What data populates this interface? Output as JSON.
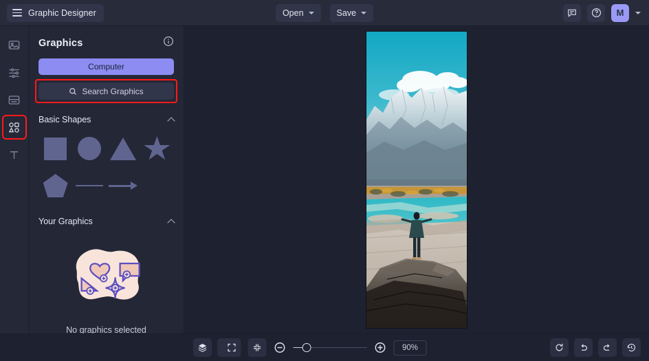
{
  "app": {
    "title": "Graphic Designer",
    "menu_icon": "hamburger-icon"
  },
  "topbar": {
    "open_label": "Open",
    "save_label": "Save",
    "comment_icon": "comment-icon",
    "help_icon": "help-circle-icon",
    "avatar_initial": "M",
    "avatar_color": "#9a9af6",
    "account_chevron": "chevron-down-icon"
  },
  "rail": {
    "items": [
      {
        "icon": "image-icon",
        "name": "images",
        "selected": false
      },
      {
        "icon": "sliders-icon",
        "name": "adjustments",
        "selected": false
      },
      {
        "icon": "layout-icon",
        "name": "pages",
        "selected": false
      },
      {
        "icon": "shapes-icon",
        "name": "graphics",
        "selected": true
      },
      {
        "icon": "text-icon",
        "name": "text",
        "selected": false
      }
    ],
    "highlight_color": "#ff1a1a"
  },
  "panel": {
    "title": "Graphics",
    "info_icon": "info-circle-icon",
    "computer_button": "Computer",
    "computer_button_color": "#8c8cf2",
    "search_button": "Search Graphics",
    "search_icon": "search-icon",
    "search_highlighted": true,
    "sections": [
      {
        "title": "Basic Shapes",
        "chevron": "chevron-up-icon",
        "shapes": [
          {
            "name": "square-shape",
            "kind": "square"
          },
          {
            "name": "circle-shape",
            "kind": "circle"
          },
          {
            "name": "triangle-shape",
            "kind": "triangle"
          },
          {
            "name": "star-shape",
            "kind": "star"
          },
          {
            "name": "pentagon-shape",
            "kind": "pentagon"
          },
          {
            "name": "line-shape",
            "kind": "line"
          },
          {
            "name": "arrow-shape",
            "kind": "arrow"
          }
        ]
      },
      {
        "title": "Your Graphics",
        "chevron": "chevron-up-icon",
        "empty_text": "No graphics selected",
        "empty_illustration": "graphics-blob-illustration"
      }
    ]
  },
  "canvas": {
    "artboard": {
      "image_description": "snow-capped mountain landscape with person standing on rock outcrop, turquoise river",
      "orientation": "portrait"
    }
  },
  "bottombar": {
    "layers_icon": "layers-icon",
    "grid_icon": "grid-icon",
    "fullscreen_icon": "fullscreen-icon",
    "fit_icon": "fit-to-screen-icon",
    "zoom_out_icon": "zoom-out-icon",
    "zoom_in_icon": "zoom-in-icon",
    "zoom_level": "90%",
    "slider_position_percent": 22,
    "reset_icon": "reset-rotate-icon",
    "undo_icon": "undo-icon",
    "redo_icon": "redo-icon",
    "history_icon": "history-clock-icon"
  }
}
